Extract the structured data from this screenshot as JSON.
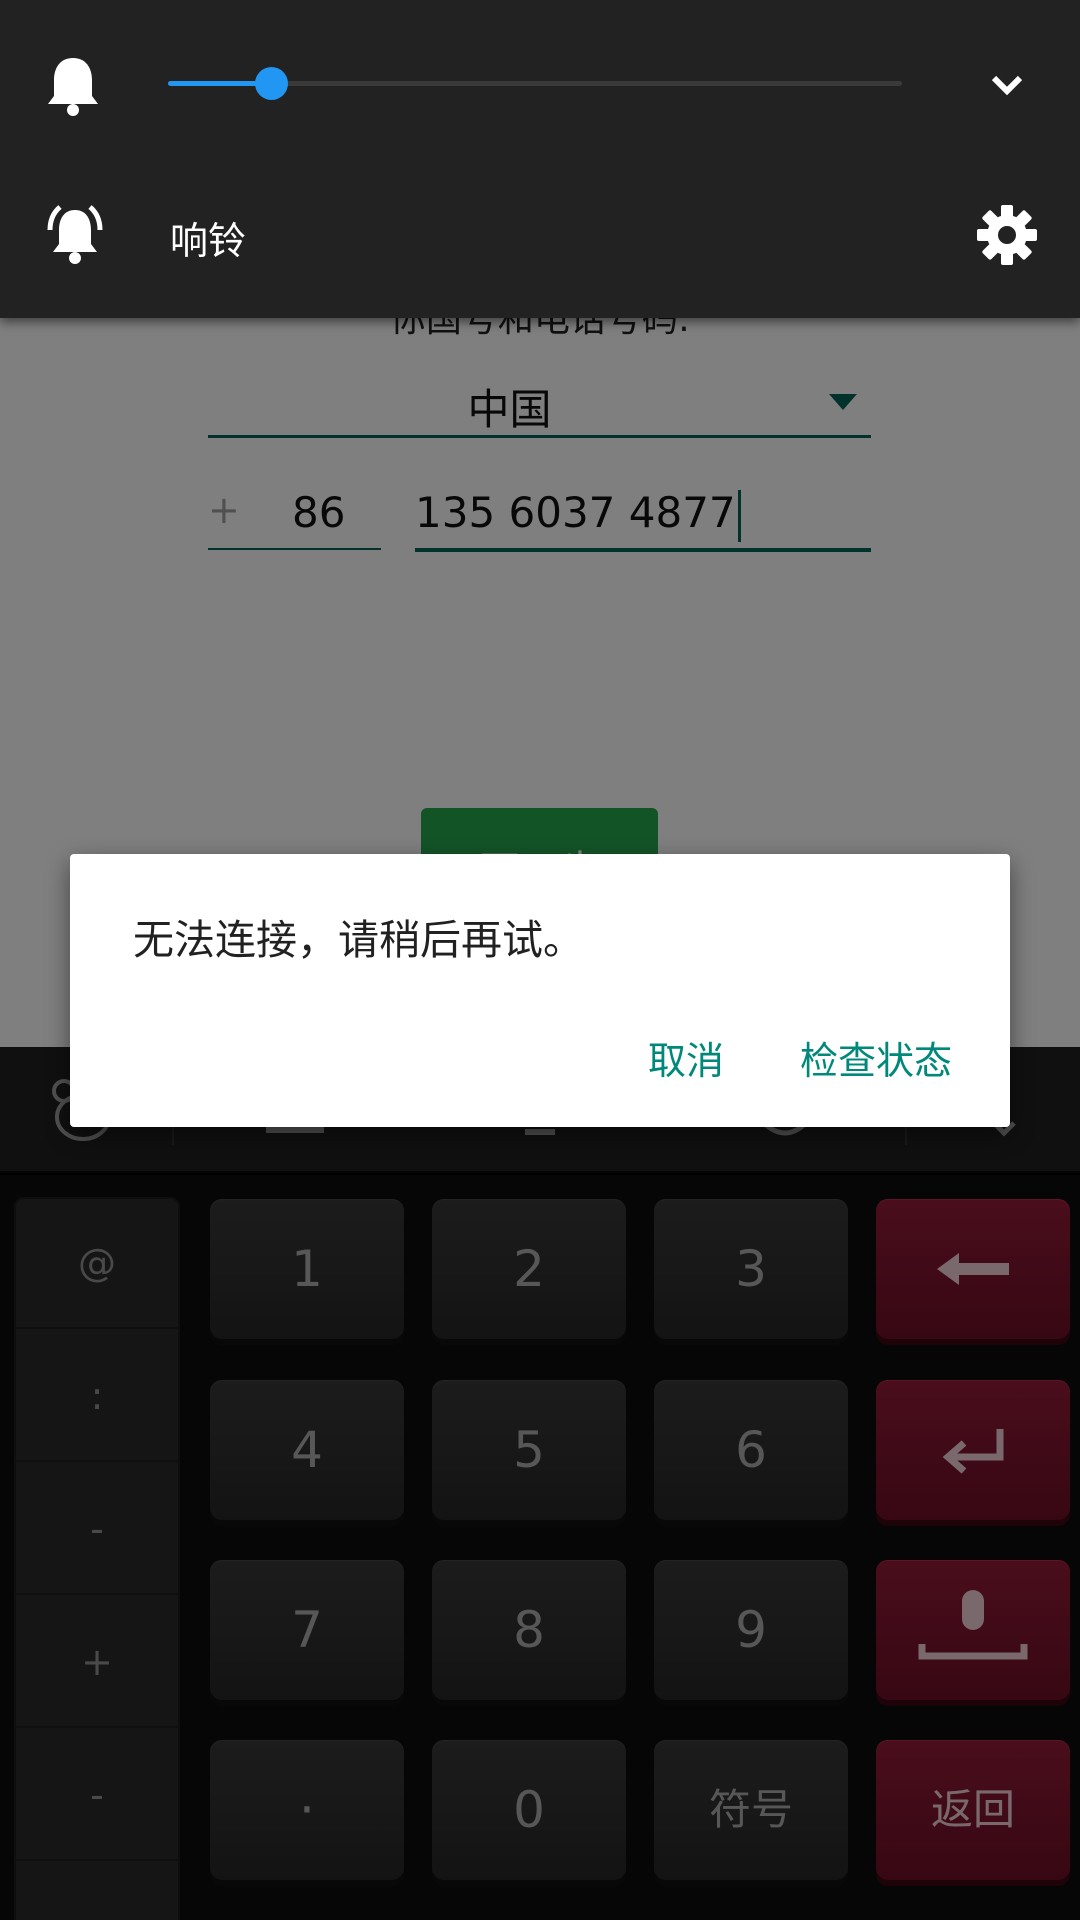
{
  "app": {
    "prompt": "你国号和电话号码:",
    "country": "中国",
    "country_code_prefix": "+",
    "country_code": "86",
    "phone_number": "135 6037 4877",
    "next_button": "下一步"
  },
  "volume_panel": {
    "level": 0.14,
    "mode_label": "响铃",
    "accent_color": "#2196f3",
    "icons": {
      "bell": "bell-icon",
      "collapse": "chevron-down-icon",
      "ringer": "ringing-bell-icon",
      "settings": "gear-icon"
    }
  },
  "dialog": {
    "message": "无法连接，请稍后再试。",
    "cancel": "取消",
    "check_status": "检查状态",
    "accent_color": "#00897b"
  },
  "keyboard": {
    "symbols": [
      "@",
      ":",
      "-",
      "+",
      "-"
    ],
    "digits": [
      "1",
      "2",
      "3",
      "4",
      "5",
      "6",
      "7",
      "8",
      "9",
      "·",
      "0"
    ],
    "symbols_key": "符号",
    "return_key": "返回",
    "accent_color": "#8e1a35"
  }
}
